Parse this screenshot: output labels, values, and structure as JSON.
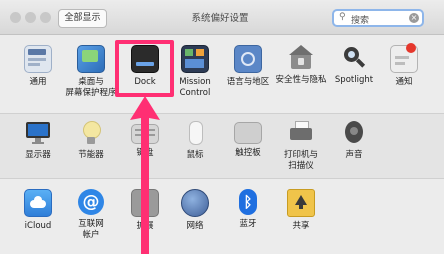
{
  "window": {
    "title": "系统偏好设置",
    "show_all_label": "全部显示",
    "search_placeholder": "搜索"
  },
  "sections": [
    {
      "items": [
        {
          "label": "通用",
          "icon": "general-icon",
          "color": "#dfe6ef"
        },
        {
          "label": "桌面与\n屏幕保护程序",
          "icon": "desktop-icon",
          "color": "#4b8fd6"
        },
        {
          "label": "Dock",
          "icon": "dock-icon",
          "color": "#2b2b2b"
        },
        {
          "label": "Mission\nControl",
          "icon": "mission-control-icon",
          "color": "#2d3b55"
        },
        {
          "label": "语言与地区",
          "icon": "globe-flag-icon",
          "color": "#5b87c7"
        },
        {
          "label": "安全性与隐私",
          "icon": "house-lock-icon",
          "color": "#8c8c8c"
        },
        {
          "label": "Spotlight",
          "icon": "spotlight-icon",
          "color": "#3b3b3b"
        },
        {
          "label": "通知",
          "icon": "notification-icon",
          "color": "#eeeeee"
        }
      ]
    },
    {
      "items": [
        {
          "label": "显示器",
          "icon": "display-icon",
          "color": "#2a72c9"
        },
        {
          "label": "节能器",
          "icon": "bulb-icon",
          "color": "#f4e7a1"
        },
        {
          "label": "键盘",
          "icon": "keyboard-icon",
          "color": "#d6d6d6"
        },
        {
          "label": "鼠标",
          "icon": "mouse-icon",
          "color": "#f2f2f2"
        },
        {
          "label": "触控板",
          "icon": "trackpad-icon",
          "color": "#cfcfcf"
        },
        {
          "label": "打印机与\n扫描仪",
          "icon": "printer-icon",
          "color": "#6d6d6d"
        },
        {
          "label": "声音",
          "icon": "speaker-icon",
          "color": "#4a4a4a"
        }
      ]
    },
    {
      "items": [
        {
          "label": "iCloud",
          "icon": "icloud-icon",
          "color": "#3a8ee8"
        },
        {
          "label": "互联网\n帐户",
          "icon": "at-icon",
          "color": "#2f86e6"
        },
        {
          "label": "扩展",
          "icon": "puzzle-icon",
          "color": "#9a9a9a"
        },
        {
          "label": "网络",
          "icon": "network-icon",
          "color": "#4f6fa8"
        },
        {
          "label": "蓝牙",
          "icon": "bluetooth-icon",
          "color": "#1f6fe0"
        },
        {
          "label": "共享",
          "icon": "sharing-icon",
          "color": "#f0c44a"
        }
      ]
    }
  ],
  "annotation": {
    "highlight_color": "#ff2f73"
  }
}
